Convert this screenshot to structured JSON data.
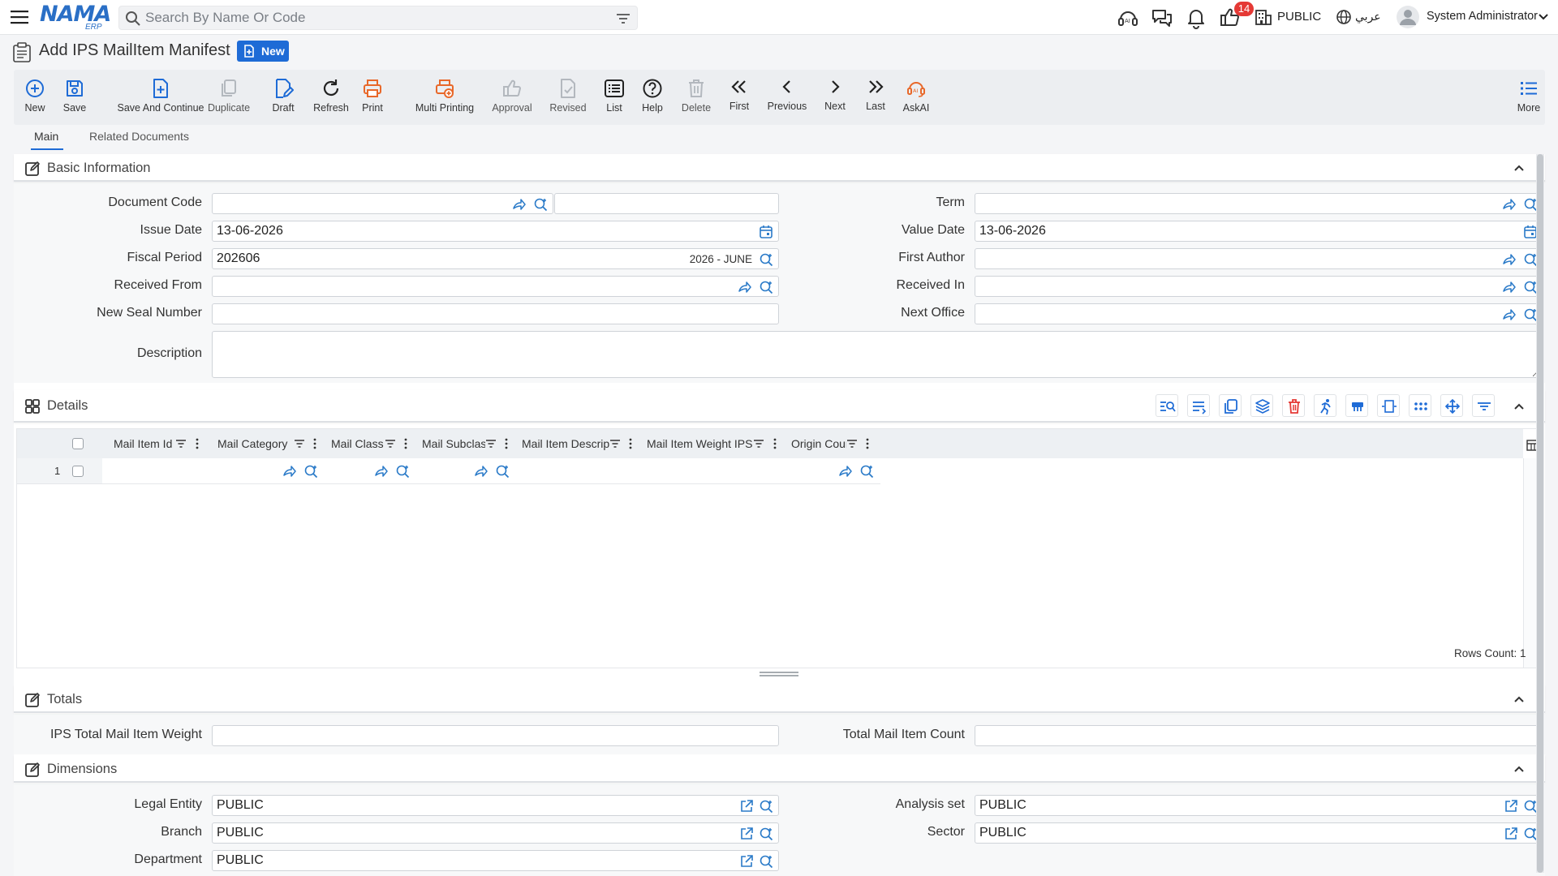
{
  "app": {
    "logo": "NAMA",
    "logo_sub": "ERP",
    "search_placeholder": "Search By Name Or Code",
    "notifications_count": "14",
    "company": "PUBLIC",
    "language": "عربي",
    "user": "System Administrator"
  },
  "page": {
    "title": "Add IPS MailItem Manifest",
    "status_badge": "New"
  },
  "toolbar": {
    "new": "New",
    "save": "Save",
    "save_continue": "Save And Continue",
    "duplicate": "Duplicate",
    "draft": "Draft",
    "refresh": "Refresh",
    "print": "Print",
    "multi_printing": "Multi Printing",
    "approval": "Approval",
    "revised": "Revised",
    "list": "List",
    "help": "Help",
    "delete": "Delete",
    "first": "First",
    "previous": "Previous",
    "next": "Next",
    "last": "Last",
    "askai": "AskAI",
    "more": "More"
  },
  "tabs": {
    "main": "Main",
    "related": "Related Documents"
  },
  "basic": {
    "title": "Basic Information",
    "document_code": {
      "label": "Document Code",
      "value": ""
    },
    "term": {
      "label": "Term",
      "value": ""
    },
    "issue_date": {
      "label": "Issue Date",
      "value": "13-06-2026"
    },
    "value_date": {
      "label": "Value Date",
      "value": "13-06-2026"
    },
    "fiscal_period": {
      "label": "Fiscal Period",
      "value": "202606",
      "suffix": "2026 - JUNE"
    },
    "first_author": {
      "label": "First Author",
      "value": ""
    },
    "received_from": {
      "label": "Received From",
      "value": ""
    },
    "received_in": {
      "label": "Received In",
      "value": ""
    },
    "new_seal_number": {
      "label": "New Seal Number",
      "value": ""
    },
    "next_office": {
      "label": "Next Office",
      "value": ""
    },
    "description": {
      "label": "Description",
      "value": ""
    }
  },
  "details": {
    "title": "Details",
    "columns": [
      "Mail Item Id",
      "Mail Category",
      "Mail Class",
      "Mail Subclass",
      "Mail Item Description",
      "Mail Item Weight IPS",
      "Origin Country"
    ],
    "rows": [
      {
        "index": "1"
      }
    ],
    "rows_count": "Rows Count: 1"
  },
  "totals": {
    "title": "Totals",
    "ips_total_weight": {
      "label": "IPS Total Mail Item Weight",
      "value": ""
    },
    "total_count": {
      "label": "Total Mail Item Count",
      "value": ""
    }
  },
  "dimensions": {
    "title": "Dimensions",
    "legal_entity": {
      "label": "Legal Entity",
      "value": "PUBLIC"
    },
    "analysis_set": {
      "label": "Analysis set",
      "value": "PUBLIC"
    },
    "branch": {
      "label": "Branch",
      "value": "PUBLIC"
    },
    "sector": {
      "label": "Sector",
      "value": "PUBLIC"
    },
    "department": {
      "label": "Department",
      "value": "PUBLIC"
    }
  },
  "colors": {
    "accent": "#1e6bd6",
    "print": "#e8682a",
    "danger": "#e53935"
  }
}
